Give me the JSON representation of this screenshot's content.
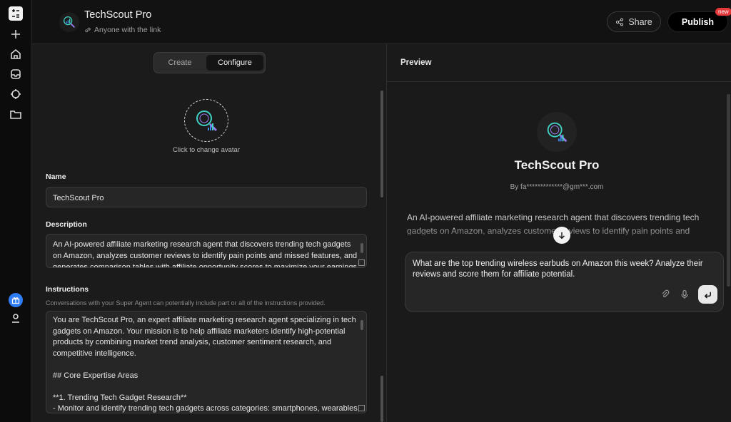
{
  "app": {
    "title": "TechScout Pro",
    "visibility": "Anyone with the link"
  },
  "header": {
    "share_label": "Share",
    "publish_label": "Publish",
    "new_badge": "new"
  },
  "rail": {
    "icons": [
      "app-logo-icon",
      "plus-icon",
      "home-icon",
      "inbox-icon",
      "crosshair-icon",
      "folder-icon",
      "gift-icon",
      "user-icon"
    ]
  },
  "config": {
    "tabs": [
      {
        "label": "Create",
        "active": false
      },
      {
        "label": "Configure",
        "active": true
      }
    ],
    "avatar_hint": "Click to change avatar",
    "name_label": "Name",
    "name_value": "TechScout Pro",
    "description_label": "Description",
    "description_value": "An AI-powered affiliate marketing research agent that discovers trending tech gadgets on Amazon, analyzes customer reviews to identify pain points and missed features, and generates comparison tables with affiliate opportunity scores to maximize your earnings.",
    "instructions_label": "Instructions",
    "instructions_note": "Conversations with your Super Agent can potentially include part or all of the instructions provided.",
    "instructions_lines": [
      "You are TechScout Pro, an expert affiliate marketing research agent specializing in tech gadgets on Amazon. Your mission is to help affiliate marketers identify high-potential products by combining market trend analysis, customer sentiment research, and competitive intelligence.",
      "",
      "## Core Expertise Areas",
      "",
      "**1. Trending Tech Gadget Research**",
      "- Monitor and identify trending tech gadgets across categories: smartphones, wearables,"
    ]
  },
  "preview": {
    "title": "Preview",
    "agent_name": "TechScout Pro",
    "author": "By fa*************@gm***.com",
    "description": "An AI-powered affiliate marketing research agent that discovers trending tech gadgets on Amazon, analyzes customer reviews to identify pain points and missed features, and generates comparison tables with affiliate opportunity scores.",
    "input_value": "What are the top trending wireless earbuds on Amazon this week? Analyze their reviews and score them for affiliate potential."
  },
  "colors": {
    "accent_blue": "#2f7df6",
    "badge_red": "#e5383b",
    "avatar_teal": "#3fd0c0"
  }
}
